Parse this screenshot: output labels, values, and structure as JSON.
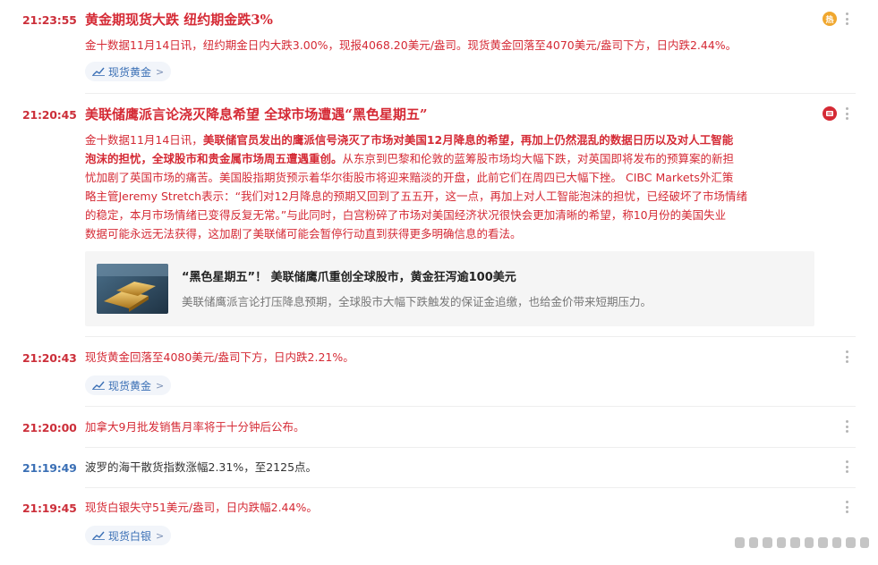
{
  "items": [
    {
      "time": "21:23:55",
      "headline": "黄金期现货大跌 纽约期金跌3%",
      "text": "金十数据11月14日讯，纽约期金日内大跌3.00%，现报4068.20美元/盎司。现货黄金回落至4070美元/盎司下方，日内跌2.44%。",
      "tag": "现货黄金",
      "badge": "热"
    },
    {
      "time": "21:20:45",
      "headline": "美联储鹰派言论浇灭降息希望 全球市场遭遇“黑色星期五”",
      "text_lines": [
        {
          "prefix": "金十数据11月14日讯，",
          "bold": "美联储官员发出的鹰派信号浇灭了市场对美国12月降息的希望，再加上仍然混乱的数据日历以及对人工智能",
          "rest": ""
        },
        {
          "prefix": "",
          "bold": "泡沫的担忧，全球股市和贵金属市场周五遭遇重创。",
          "rest": "从东京到巴黎和伦敦的蓝筹股市场均大幅下跌，对英国即将发布的预算案的新担"
        },
        {
          "prefix": "",
          "bold": "",
          "rest": "忧加剧了英国市场的痛苦。美国股指期货预示着华尔街股市将迎来黯淡的开盘，此前它们在周四已大幅下挫。 CIBC Markets外汇策"
        },
        {
          "prefix": "",
          "bold": "",
          "rest": "略主管Jeremy Stretch表示：“我们对12月降息的预期又回到了五五开，这一点，再加上对人工智能泡沫的担忧，已经破坏了市场情绪"
        },
        {
          "prefix": "",
          "bold": "",
          "rest": "的稳定，本月市场情绪已变得反复无常。”与此同时，白宫粉碎了市场对美国经济状况很快会更加清晰的希望，称10月份的美国失业"
        },
        {
          "prefix": "",
          "bold": "",
          "rest": "数据可能永远无法获得，这加剧了美联储可能会暂停行动直到获得更多明确信息的看法。"
        }
      ],
      "card": {
        "title": "“黑色星期五”！ 美联储鹰爪重创全球股市，黄金狂泻逾100美元",
        "desc": "美联储鹰派言论打压降息预期，全球股市大幅下跌触发的保证金追缴，也给金价带来短期压力。"
      }
    },
    {
      "time": "21:20:43",
      "text": "现货黄金回落至4080美元/盎司下方，日内跌2.21%。",
      "tag": "现货黄金"
    },
    {
      "time": "21:20:00",
      "text": "加拿大9月批发销售月率将于十分钟后公布。"
    },
    {
      "time": "21:19:49",
      "text": "波罗的海干散货指数涨幅2.31%，至2125点。"
    },
    {
      "time": "21:19:45",
      "text": "现货白银失守51美元/盎司，日内跌幅2.44%。",
      "tag": "现货白银"
    }
  ],
  "colors": {
    "important": "#d52a35",
    "time_red": "#cc2f3a",
    "time_blue": "#3a6fb5",
    "tag_text": "#3a6fb5",
    "tag_bg": "#f2f5fa"
  },
  "icons": {
    "tag": "trend-chart-icon",
    "more": "more-vertical-icon",
    "hot": "hot-badge-icon",
    "flag": "important-badge-icon"
  }
}
